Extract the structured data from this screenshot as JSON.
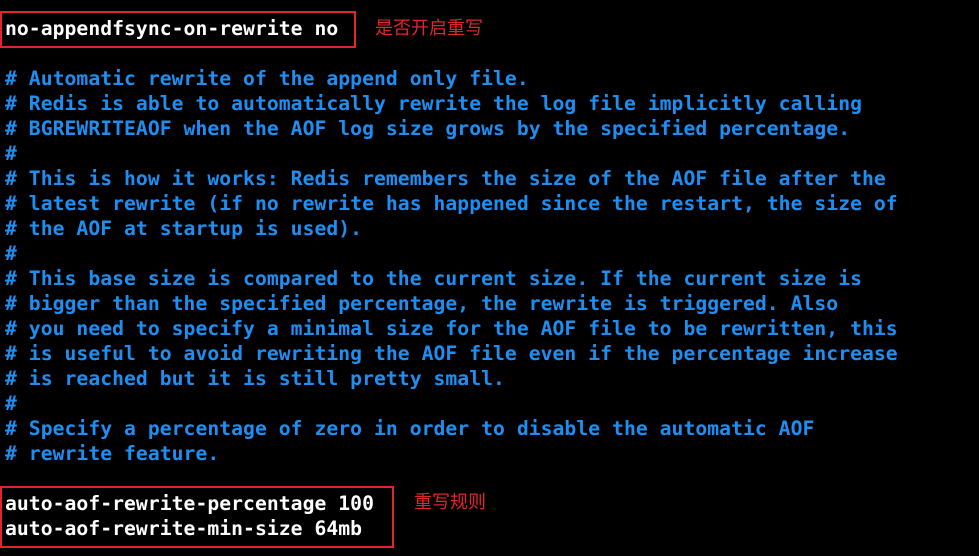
{
  "config_top": {
    "line": "no-appendfsync-on-rewrite no",
    "annotation": "是否开启重写"
  },
  "comments": [
    "# Automatic rewrite of the append only file.",
    "# Redis is able to automatically rewrite the log file implicitly calling",
    "# BGREWRITEAOF when the AOF log size grows by the specified percentage.",
    "#",
    "# This is how it works: Redis remembers the size of the AOF file after the",
    "# latest rewrite (if no rewrite has happened since the restart, the size of",
    "# the AOF at startup is used).",
    "#",
    "# This base size is compared to the current size. If the current size is",
    "# bigger than the specified percentage, the rewrite is triggered. Also",
    "# you need to specify a minimal size for the AOF file to be rewritten, this",
    "# is useful to avoid rewriting the AOF file even if the percentage increase",
    "# is reached but it is still pretty small.",
    "#",
    "# Specify a percentage of zero in order to disable the automatic AOF",
    "# rewrite feature."
  ],
  "config_bottom": {
    "lines": [
      "auto-aof-rewrite-percentage 100",
      "auto-aof-rewrite-min-size 64mb"
    ],
    "annotation": "重写规则"
  },
  "colors": {
    "background": "#000000",
    "comment": "#1e8ff2",
    "setting": "#ffffff",
    "annotation": "#e0262b"
  }
}
